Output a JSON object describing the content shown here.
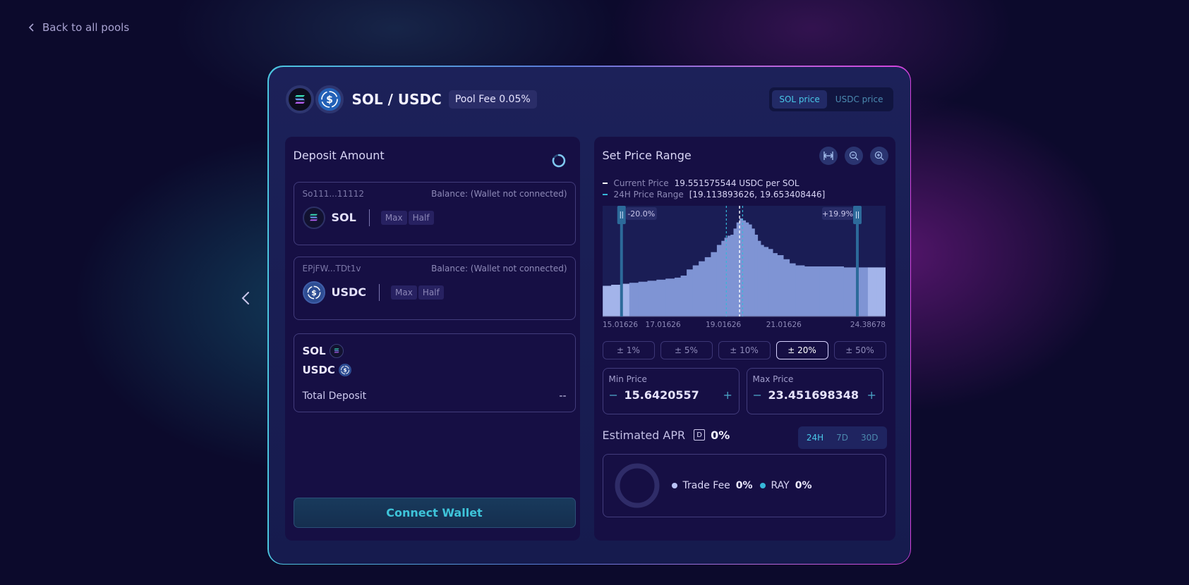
{
  "nav": {
    "back_label": "Back to all pools"
  },
  "pool": {
    "pair": "SOL / USDC",
    "fee": "Pool Fee 0.05%",
    "toggle": {
      "sol": "SOL price",
      "usdc": "USDC price",
      "active": "SOL price"
    }
  },
  "deposit": {
    "title": "Deposit Amount",
    "token_a": {
      "mint": "So111...11112",
      "balance": "Balance: (Wallet not connected)",
      "symbol": "SOL",
      "max": "Max",
      "half": "Half"
    },
    "token_b": {
      "mint": "EPjFW...TDt1v",
      "balance": "Balance: (Wallet not connected)",
      "symbol": "USDC",
      "max": "Max",
      "half": "Half"
    },
    "summary": {
      "sol": "SOL",
      "usdc": "USDC",
      "total_label": "Total Deposit",
      "total_value": "--"
    },
    "connect_label": "Connect Wallet"
  },
  "range": {
    "title": "Set Price Range",
    "current_label": "Current Price",
    "current_value": "19.551575544 USDC per SOL",
    "h24_label": "24H Price Range",
    "h24_value": "[19.113893626, 19.653408446]",
    "min_handle_label": "-20.0%",
    "max_handle_label": "+19.9%",
    "buttons": [
      "± 1%",
      "± 5%",
      "± 10%",
      "± 20%",
      "± 50%"
    ],
    "active_button": "± 20%",
    "min_label": "Min Price",
    "min_value": "15.6420557",
    "max_label": "Max Price",
    "max_value": "23.451698348"
  },
  "apr": {
    "label": "Estimated APR",
    "badge": "D",
    "value": "0%",
    "periods": [
      "24H",
      "7D",
      "30D"
    ],
    "active_period": "24H",
    "trade_fee_label": "Trade Fee",
    "trade_fee_value": "0%",
    "ray_label": "RAY",
    "ray_value": "0%"
  },
  "colors": {
    "accent": "#49c8e8",
    "bar_fill": "#7f94d4",
    "bar_fill_outside": "#a3b4ea",
    "handle": "#2c6a9a",
    "trade_fee_dot": "#b9c3f5",
    "ray_dot": "#36b7d9"
  },
  "chart_data": {
    "type": "area",
    "title": "",
    "xlabel": "",
    "ylabel": "",
    "xlim": [
      15.01626,
      24.38678
    ],
    "tick_labels": [
      "15.01626",
      "17.01626",
      "19.01626",
      "21.01626",
      "24.38678"
    ],
    "tick_values": [
      15.01626,
      17.01626,
      19.01626,
      21.01626,
      24.38678
    ],
    "current_price": 19.551575544,
    "range_24h": [
      19.113893626,
      19.653408446
    ],
    "range_min": 15.6420557,
    "range_max": 23.451698348,
    "liquidity_x": [
      15.02,
      15.3,
      15.6,
      15.9,
      16.2,
      16.5,
      16.8,
      17.1,
      17.4,
      17.6,
      17.8,
      18.0,
      18.2,
      18.4,
      18.6,
      18.8,
      18.95,
      19.05,
      19.15,
      19.25,
      19.35,
      19.45,
      19.55,
      19.65,
      19.75,
      19.85,
      19.95,
      20.05,
      20.15,
      20.25,
      20.35,
      20.5,
      20.65,
      20.8,
      21.0,
      21.2,
      21.4,
      21.55,
      21.7,
      21.9,
      22.2,
      22.6,
      23.0,
      23.4,
      23.8,
      24.1,
      24.38
    ],
    "liquidity_y": [
      0.3,
      0.31,
      0.32,
      0.33,
      0.34,
      0.35,
      0.36,
      0.37,
      0.38,
      0.4,
      0.46,
      0.5,
      0.54,
      0.58,
      0.63,
      0.7,
      0.74,
      0.77,
      0.79,
      0.8,
      0.86,
      0.92,
      0.96,
      0.94,
      0.92,
      0.9,
      0.86,
      0.8,
      0.74,
      0.7,
      0.68,
      0.66,
      0.62,
      0.6,
      0.56,
      0.52,
      0.5,
      0.5,
      0.49,
      0.49,
      0.49,
      0.49,
      0.48,
      0.48,
      0.48,
      0.48,
      0.48
    ]
  }
}
